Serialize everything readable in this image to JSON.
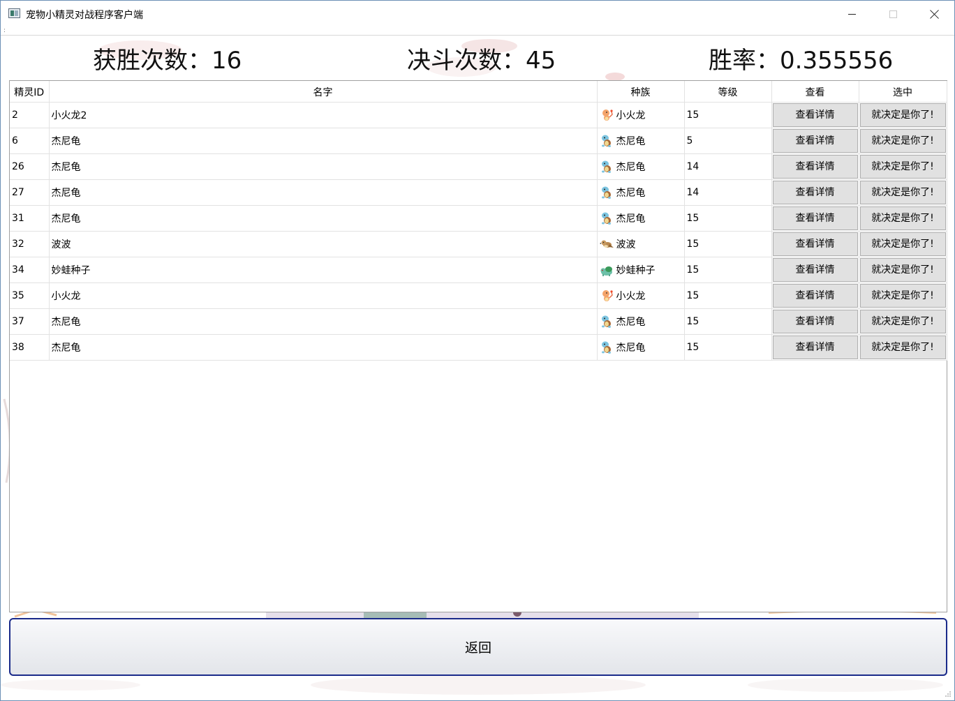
{
  "window": {
    "title": "宠物小精灵对战程序客户端",
    "menu_grip": ":"
  },
  "stats": {
    "wins": "获胜次数：16",
    "battles": "决斗次数：45",
    "win_rate": "胜率：0.355556"
  },
  "table": {
    "headers": [
      "精灵ID",
      "名字",
      "种族",
      "等级",
      "查看",
      "选中"
    ],
    "rows": [
      {
        "id": "2",
        "name": "小火龙2",
        "species": "小火龙",
        "sprite": "charmander",
        "level": "15",
        "view": "查看详情",
        "select": "就决定是你了!"
      },
      {
        "id": "6",
        "name": "杰尼龟",
        "species": "杰尼龟",
        "sprite": "squirtle",
        "level": "5",
        "view": "查看详情",
        "select": "就决定是你了!"
      },
      {
        "id": "26",
        "name": "杰尼龟",
        "species": "杰尼龟",
        "sprite": "squirtle",
        "level": "14",
        "view": "查看详情",
        "select": "就决定是你了!"
      },
      {
        "id": "27",
        "name": "杰尼龟",
        "species": "杰尼龟",
        "sprite": "squirtle",
        "level": "14",
        "view": "查看详情",
        "select": "就决定是你了!"
      },
      {
        "id": "31",
        "name": "杰尼龟",
        "species": "杰尼龟",
        "sprite": "squirtle",
        "level": "15",
        "view": "查看详情",
        "select": "就决定是你了!"
      },
      {
        "id": "32",
        "name": "波波",
        "species": "波波",
        "sprite": "pidgey",
        "level": "15",
        "view": "查看详情",
        "select": "就决定是你了!"
      },
      {
        "id": "34",
        "name": "妙蛙种子",
        "species": "妙蛙种子",
        "sprite": "bulbasaur",
        "level": "15",
        "view": "查看详情",
        "select": "就决定是你了!"
      },
      {
        "id": "35",
        "name": "小火龙",
        "species": "小火龙",
        "sprite": "charmander",
        "level": "15",
        "view": "查看详情",
        "select": "就决定是你了!"
      },
      {
        "id": "37",
        "name": "杰尼龟",
        "species": "杰尼龟",
        "sprite": "squirtle",
        "level": "15",
        "view": "查看详情",
        "select": "就决定是你了!"
      },
      {
        "id": "38",
        "name": "杰尼龟",
        "species": "杰尼龟",
        "sprite": "squirtle",
        "level": "15",
        "view": "查看详情",
        "select": "就决定是你了!"
      }
    ]
  },
  "back_button": {
    "label": "返回"
  },
  "colors": {
    "button_bg": "#e1e1e1",
    "back_border": "#1a2a8a",
    "grid": "#e2e2e2"
  }
}
